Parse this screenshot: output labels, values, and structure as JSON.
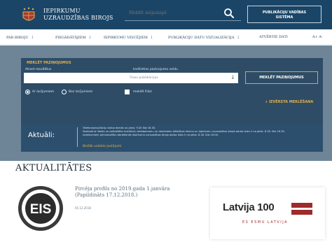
{
  "header": {
    "brand_line1": "IEPIRKUMU",
    "brand_line2": "UZRAUDZĪBAS BIROJS",
    "search_placeholder": "Meklēt mājaslapā",
    "pvs_line1": "PUBLIKĀCIJU VADĪBAS",
    "pvs_line2": "SISTĒMA"
  },
  "nav": {
    "items": [
      {
        "label": "PAR BIROJU"
      },
      {
        "label": "PIEGĀDĀTĀJIEM"
      },
      {
        "label": "IEPIRKUMU VEICĒJIEM"
      },
      {
        "label": "PUBLIKĀCIJU DATU VIZUALIZĀCIJA"
      },
      {
        "label": "ATVĒRTIE DATI"
      }
    ],
    "font_size_controls": "A+  A-"
  },
  "search_panel": {
    "title": "MEKLĒT PAZIŅOJUMUS",
    "keyword_label": "Atrast rezultātus",
    "keyword_value": "",
    "type_label": "Izvēlieties paziņojuma veidu",
    "type_value": "Visas publikācijas",
    "submit_label": "MEKLĒT PAZIŅOJUMUS",
    "radio_option_1": "Ar locījumiem",
    "radio_option_2": "Bez locījumiem",
    "radio_selected": "Ar locījumiem",
    "checkbox_label": "meklēt frāzi",
    "advanced_label": "IZVĒRSTA MEKLĒŠANA"
  },
  "news_bar": {
    "title": "Aktuāli:",
    "line1": "Telefonkonsultāciju darba dienās no plkst. 9.00 līdz 16.30.",
    "line2": "Saskaņā ar Valsts un pašvaldību institūciju amatpersonu un darbinieku atlīdzības likumu un iepirkumu uzraudzības biroja darba laiks ir no plkst. 8.30. līdz 16.30.",
    "line3": "noteikumiem pirmsssvētku darbdienās iepirkumu uzraudzības biroja darba laiks ir no plkst. 8.30. līdz 16.00.",
    "link": "Biežāk uzdotie jautājumi"
  },
  "news_section": {
    "title": "AKTUALITĀTES",
    "article_title_line1": "Pircēja profils no 2019.gada 1.janvāra",
    "article_title_line2": "(Papildināts 17.12.2018.)",
    "article_date": "05.12.2018",
    "eis_logo_text": "EIS",
    "latvija_wordmark": "Latvija 100",
    "latvija_tagline": "ES ESMU LATVIJA"
  },
  "colors": {
    "header_bg": "#1b4567",
    "accent_gold": "#e3b24a",
    "hero_bg": "#6d8597",
    "panel_bg": "#2e4c66",
    "flag_red": "#9e2b2b"
  },
  "icons": [
    "coat-of-arms-icon",
    "search-icon",
    "chevron-down-icon",
    "arrow-down-icon",
    "eis-logo-icon",
    "latvia-flag-icon"
  ]
}
